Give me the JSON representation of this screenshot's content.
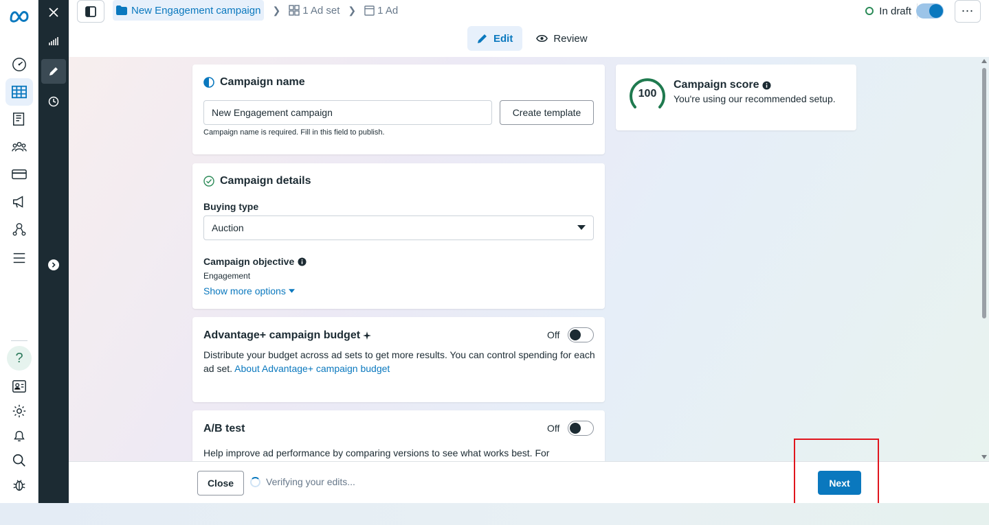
{
  "breadcrumb": {
    "campaign": "New Engagement campaign",
    "adset": "1 Ad set",
    "ad": "1 Ad"
  },
  "status": {
    "label": "In draft"
  },
  "mode_tabs": {
    "edit": "Edit",
    "review": "Review"
  },
  "campaign_name_card": {
    "title": "Campaign name",
    "value": "New Engagement campaign",
    "create_template": "Create template",
    "helper": "Campaign name is required. Fill in this field to publish."
  },
  "campaign_details_card": {
    "title": "Campaign details",
    "buying_type_label": "Buying type",
    "buying_type_value": "Auction",
    "objective_label": "Campaign objective",
    "objective_value": "Engagement",
    "show_more": "Show more options"
  },
  "budget_card": {
    "title": "Advantage+ campaign budget",
    "toggle_label": "Off",
    "description": "Distribute your budget across ad sets to get more results. You can control spending for each ad set.",
    "link": "About Advantage+ campaign budget"
  },
  "ab_card": {
    "title": "A/B test",
    "toggle_label": "Off",
    "description": "Help improve ad performance by comparing versions to see what works best. For"
  },
  "score_card": {
    "score": "100",
    "title": "Campaign score",
    "subtitle": "You're using our recommended setup."
  },
  "footer": {
    "close": "Close",
    "verifying": "Verifying your edits...",
    "next": "Next"
  },
  "colors": {
    "accent": "#0a78be",
    "score": "#1f7a4f",
    "highlight": "#e0141c"
  }
}
